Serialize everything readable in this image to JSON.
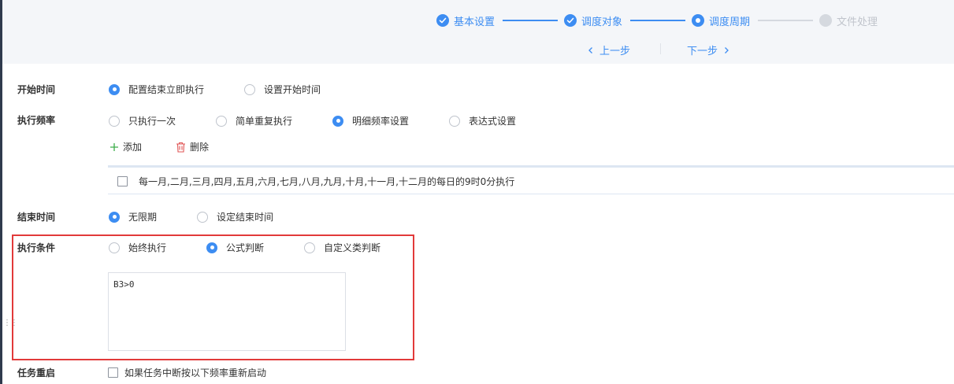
{
  "steps": [
    {
      "label": "基本设置",
      "status": "done"
    },
    {
      "label": "调度对象",
      "status": "done"
    },
    {
      "label": "调度周期",
      "status": "current"
    },
    {
      "label": "文件处理",
      "status": "pending"
    }
  ],
  "nav": {
    "prev": "上一步",
    "next": "下一步"
  },
  "start_time": {
    "label": "开始时间",
    "options": [
      "配置结束立即执行",
      "设置开始时间"
    ],
    "selected": "配置结束立即执行"
  },
  "frequency": {
    "label": "执行频率",
    "options": [
      "只执行一次",
      "简单重复执行",
      "明细频率设置",
      "表达式设置"
    ],
    "selected": "明细频率设置",
    "add_label": "添加",
    "delete_label": "删除",
    "rules": [
      "每一月,二月,三月,四月,五月,六月,七月,八月,九月,十月,十一月,十二月的每日的9时0分执行"
    ]
  },
  "end_time": {
    "label": "结束时间",
    "options": [
      "无限期",
      "设定结束时间"
    ],
    "selected": "无限期"
  },
  "condition": {
    "label": "执行条件",
    "options": [
      "始终执行",
      "公式判断",
      "自定义类判断"
    ],
    "selected": "公式判断",
    "formula": "B3>0"
  },
  "restart": {
    "label": "任务重启",
    "checkbox_label": "如果任务中断按以下频率重新启动"
  },
  "colors": {
    "accent": "#3d8df2",
    "highlight": "#e23a3a",
    "inactive": "#c0c4cc"
  }
}
